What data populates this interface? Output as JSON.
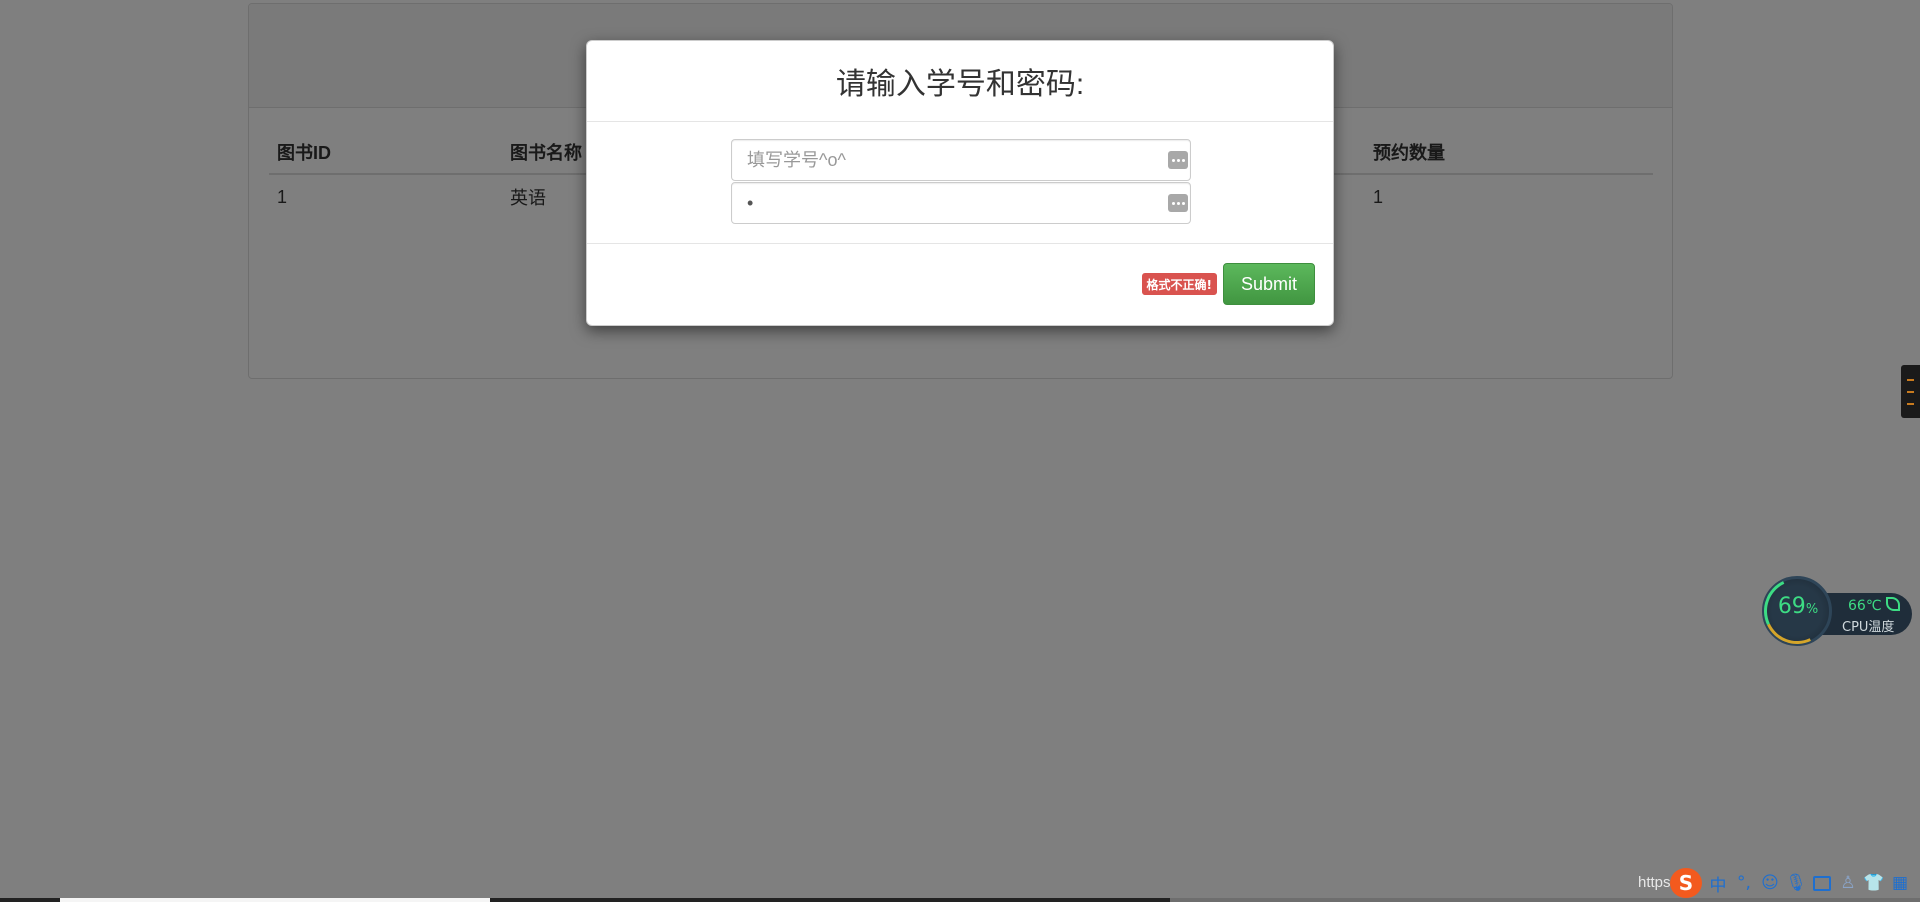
{
  "table": {
    "headers": [
      "图书ID",
      "图书名称",
      "预约数量"
    ],
    "rows": [
      [
        "1",
        "英语",
        "1"
      ]
    ]
  },
  "modal": {
    "title": "请输入学号和密码:",
    "student_id": {
      "placeholder": "填写学号^o^",
      "value": ""
    },
    "password": {
      "value": "•"
    },
    "error_badge": "格式不正确!",
    "submit_label": "Submit"
  },
  "cpu_widget": {
    "usage_value": "69",
    "usage_unit": "%",
    "temperature": "66℃",
    "label": "CPU温度",
    "accent_color": "#3ddc84"
  },
  "taskbar": {
    "url_fragment": "https:",
    "ime_logo": "S",
    "ime_mode": "中",
    "ime_punct": "°,",
    "icons": [
      "smiley-icon",
      "microphone-icon",
      "keyboard-icon",
      "person-icon",
      "shirt-icon",
      "grid-icon"
    ]
  },
  "colors": {
    "submit_button": "#449d44",
    "error_badge": "#d9534f",
    "overlay": "rgba(0,0,0,0.5)"
  }
}
